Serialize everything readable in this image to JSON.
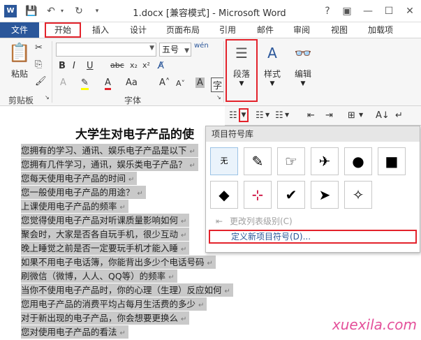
{
  "app": {
    "title": "1.docx [兼容模式] - Microsoft Word",
    "logo": "W",
    "title_controls": [
      "?",
      "▣",
      "—",
      "☐",
      "✕"
    ]
  },
  "tabs": [
    "文件",
    "开始",
    "插入",
    "设计",
    "页面布局",
    "引用",
    "邮件",
    "审阅",
    "视图",
    "加载项"
  ],
  "ribbon": {
    "paste_label": "粘贴",
    "clipboard_label": "剪贴板",
    "font_size": "五号",
    "font_group_label": "字体",
    "paragraph_label": "段落",
    "styles_label": "样式",
    "editing_label": "编辑"
  },
  "document": {
    "title": "大学生对电子产品的使",
    "lines": [
      "您拥有的学习、通讯、娱乐电子产品是以下",
      "您拥有几件学习，通讯，娱乐类电子产品？",
      "您每天使用电子产品的时间",
      "您一般使用电子产品的用途？",
      "上课使用电子产品的频率",
      "您觉得使用电子产品对听课质量影响如何",
      "聚会时，大家是否各自玩手机，很少互动",
      "晚上睡觉之前是否一定要玩手机才能入睡",
      "如果不用电子电话簿，你能背出多少个电话号码",
      "刷微信（微博，人人、QQ等）的频率",
      "当你不使用电子产品时，你的心理（生理）反应如何",
      "您用电子产品的消费平均占每月生活费的多少",
      "对于新出现的电子产品，你会想要更换么",
      "您对使用电子产品的看法"
    ]
  },
  "bullet_dropdown": {
    "header": "项目符号库",
    "none_label": "无",
    "symbols": [
      "✎",
      "☞",
      "✈",
      "●",
      "■",
      "◆",
      "⊹",
      "✔",
      "➤",
      "✧"
    ],
    "change_level": "更改列表级别(C)",
    "define_new": "定义新项目符号(D)..."
  },
  "watermark": "xuexila.com"
}
